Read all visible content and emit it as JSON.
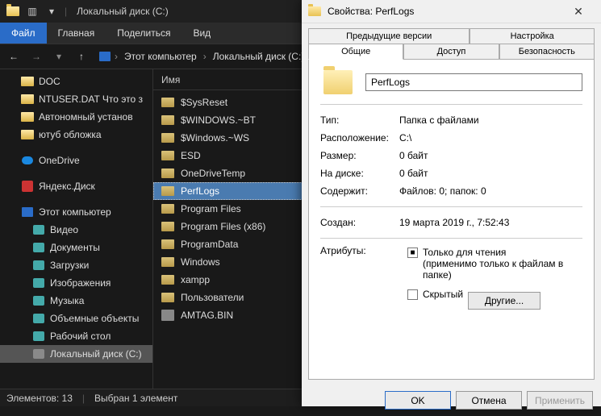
{
  "titlebar": {
    "title": "Локальный диск (C:)"
  },
  "menu": {
    "file": "Файл",
    "home": "Главная",
    "share": "Поделиться",
    "view": "Вид"
  },
  "breadcrumb": {
    "pc": "Этот компьютер",
    "disk": "Локальный диск (C:)"
  },
  "sidebar": {
    "quick": [
      {
        "label": "DOC"
      },
      {
        "label": "NTUSER.DAT Что это з"
      },
      {
        "label": "Автономный установ"
      },
      {
        "label": "ютуб обложка"
      }
    ],
    "onedrive": "OneDrive",
    "yandex": "Яндекс.Диск",
    "thispc": "Этот компьютер",
    "pcitems": [
      {
        "label": "Видео"
      },
      {
        "label": "Документы"
      },
      {
        "label": "Загрузки"
      },
      {
        "label": "Изображения"
      },
      {
        "label": "Музыка"
      },
      {
        "label": "Объемные объекты"
      },
      {
        "label": "Рабочий стол"
      },
      {
        "label": "Локальный диск (C:)"
      }
    ]
  },
  "content": {
    "header_name": "Имя",
    "items": [
      {
        "label": "$SysReset"
      },
      {
        "label": "$WINDOWS.~BT"
      },
      {
        "label": "$Windows.~WS"
      },
      {
        "label": "ESD"
      },
      {
        "label": "OneDriveTemp"
      },
      {
        "label": "PerfLogs",
        "selected": true
      },
      {
        "label": "Program Files"
      },
      {
        "label": "Program Files (x86)"
      },
      {
        "label": "ProgramData"
      },
      {
        "label": "Windows"
      },
      {
        "label": "xampp"
      },
      {
        "label": "Пользователи"
      },
      {
        "label": "AMTAG.BIN",
        "bin": true
      }
    ]
  },
  "status": {
    "count": "Элементов: 13",
    "selected": "Выбран 1 элемент"
  },
  "dialog": {
    "title": "Свойства: PerfLogs",
    "tabs": {
      "prev": "Предыдущие версии",
      "custom": "Настройка",
      "general": "Общие",
      "access": "Доступ",
      "security": "Безопасность"
    },
    "folder_name": "PerfLogs",
    "rows": {
      "type_l": "Тип:",
      "type_v": "Папка с файлами",
      "loc_l": "Расположение:",
      "loc_v": "C:\\",
      "size_l": "Размер:",
      "size_v": "0 байт",
      "disk_l": "На диске:",
      "disk_v": "0 байт",
      "contains_l": "Содержит:",
      "contains_v": "Файлов: 0; папок: 0",
      "created_l": "Создан:",
      "created_v": "19 марта 2019 г., 7:52:43",
      "attr_l": "Атрибуты:"
    },
    "readonly": "Только для чтения",
    "readonly_note": "(применимо только к файлам в папке)",
    "hidden": "Скрытый",
    "other_btn": "Другие...",
    "ok": "OK",
    "cancel": "Отмена",
    "apply": "Применить"
  }
}
